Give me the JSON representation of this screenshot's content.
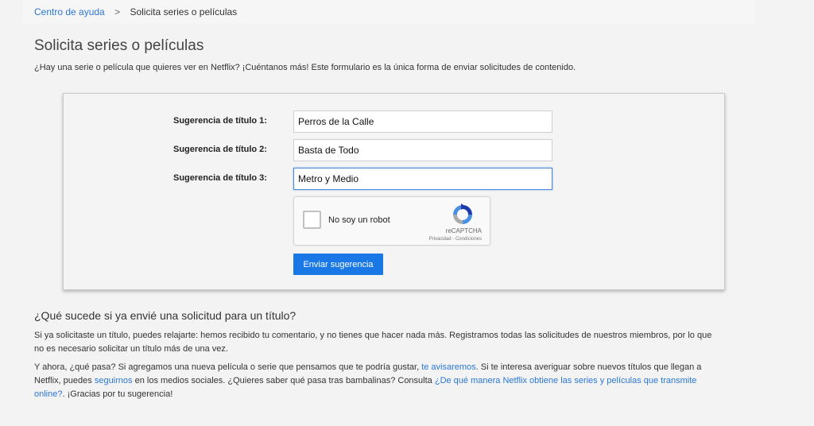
{
  "breadcrumb": {
    "home": "Centro de ayuda",
    "separator": ">",
    "current": "Solicita series o películas"
  },
  "page": {
    "title": "Solicita series o películas",
    "intro": "¿Hay una serie o película que quieres ver en Netflix? ¡Cuéntanos más! Este formulario es la única forma de enviar solicitudes de contenido."
  },
  "form": {
    "fields": [
      {
        "label": "Sugerencia de título 1:",
        "value": "Perros de la Calle"
      },
      {
        "label": "Sugerencia de título 2:",
        "value": "Basta de Todo"
      },
      {
        "label": "Sugerencia de título 3:",
        "value": "Metro y Medio"
      }
    ],
    "captcha": {
      "label": "No soy un robot",
      "brand": "reCAPTCHA",
      "links": "Privacidad - Condiciones",
      "icon": "recaptcha-icon"
    },
    "submit_label": "Enviar sugerencia"
  },
  "faq": {
    "title": "¿Qué sucede si ya envié una solicitud para un título?",
    "p1_line1": "Si ya solicitaste un título, puedes relajarte: hemos recibido tu comentario, y no tienes que hacer nada más. Registramos todas las solicitudes de nuestros miembros, por lo que",
    "p1_line2": "no es necesario solicitar un título más de una vez.",
    "p2_a": "Y ahora, ¿qué pasa? Si agregamos una nueva película o serie que pensamos que te podría gustar, ",
    "p2_link1": "te avisaremos",
    "p2_b": ". Si te interesa averiguar sobre nuevos títulos que llegan a",
    "p2_c": "Netflix, puedes ",
    "p2_link2": "seguirnos",
    "p2_d": " en los medios sociales. ¿Quieres saber qué pasa tras bambalinas? Consulta ",
    "p2_link3a": "¿De qué manera Netflix obtiene las series y películas que transmite",
    "p2_link3b": "online?",
    "p2_e": ". ¡Gracias por tu sugerencia!"
  },
  "colors": {
    "accent": "#1a78e6",
    "link": "#2a77d6",
    "background": "#f3f3f3"
  }
}
